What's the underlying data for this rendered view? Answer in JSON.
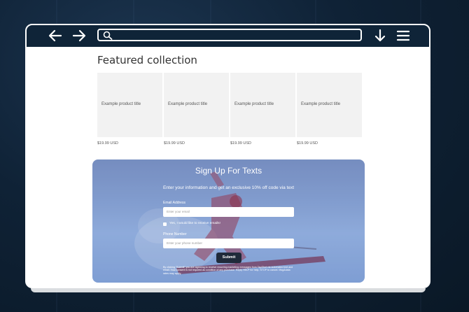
{
  "browser": {
    "back_icon": "arrow-left-icon",
    "forward_icon": "arrow-right-icon",
    "search_icon": "search-icon",
    "address_value": "",
    "download_icon": "arrow-down-icon",
    "menu_icon": "hamburger-menu-icon"
  },
  "featured": {
    "title": "Featured collection",
    "products": [
      {
        "title": "Example product title",
        "price": "$19.99 USD"
      },
      {
        "title": "Example product title",
        "price": "$19.99 USD"
      },
      {
        "title": "Example product title",
        "price": "$19.99 USD"
      },
      {
        "title": "Example product title",
        "price": "$19.99 USD"
      }
    ]
  },
  "signup": {
    "title": "Sign Up For Texts",
    "subtitle": "Enter your information and get an exclusive 10% off code via text",
    "email_label": "Email Address",
    "email_placeholder": "Enter your email",
    "consent_label": "Yes, I would like to receive emails!",
    "phone_label": "Phone Number",
    "phone_placeholder": "Enter your phone number",
    "submit_label": "Submit",
    "disclaimer": "By clicking \"Submit\" you are agreeing to receive recurring marketing messages from TapShot via automated text and email. Your consent is not required as condition of any purchase. Reply HELP for help, STOP to cancel. Msg&data rates may apply."
  },
  "colors": {
    "toolbar": "#0f2438",
    "background": "#0f2236",
    "submit": "#1f2a3a",
    "product_placeholder": "#f2f2f2"
  }
}
